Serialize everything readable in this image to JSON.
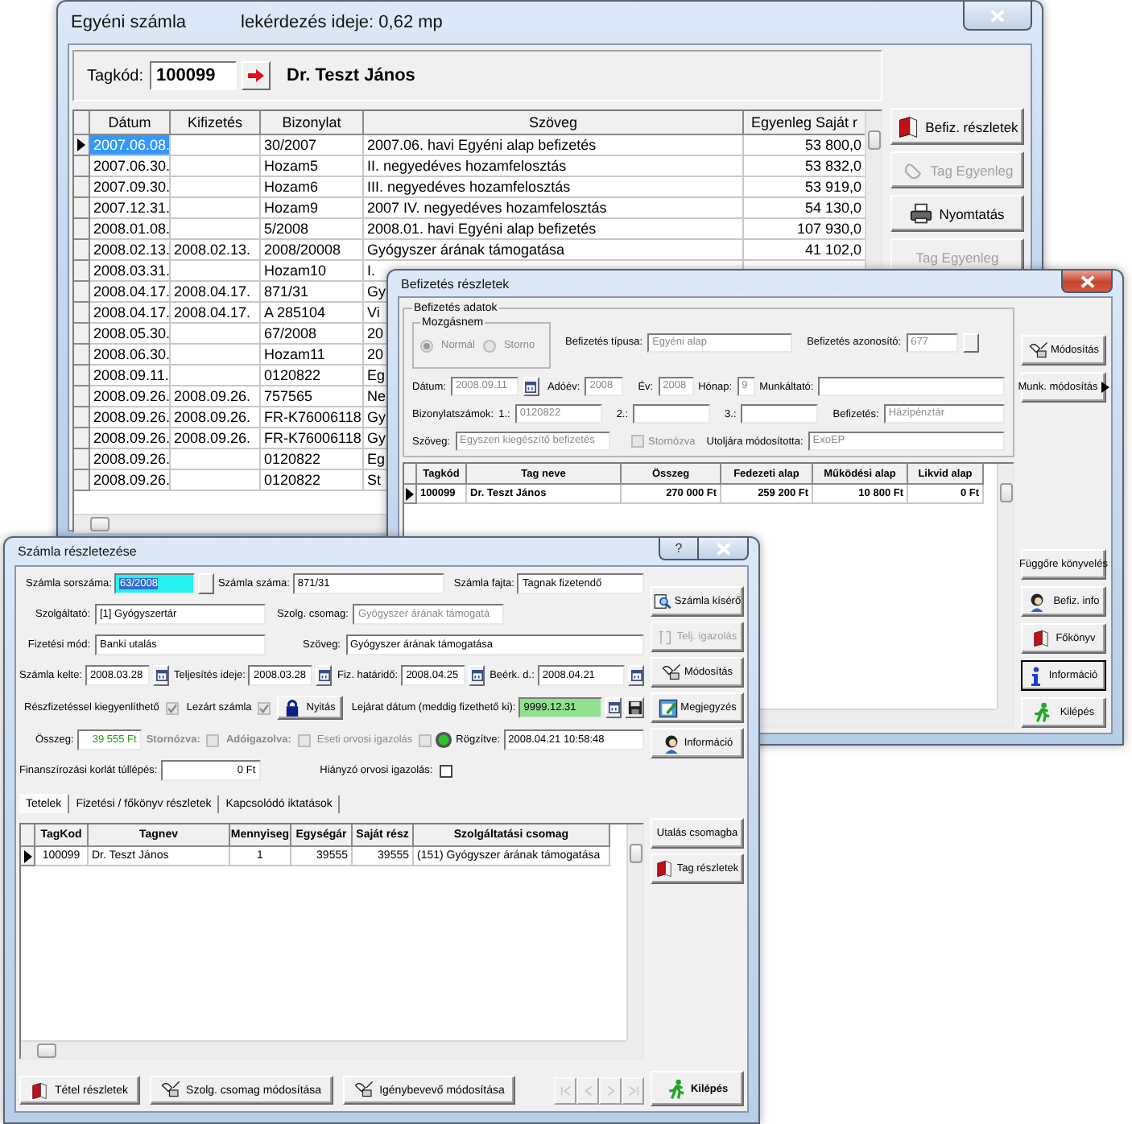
{
  "account_window": {
    "active": false,
    "title": "Egyéni számla",
    "query_time": "lekérdezés ideje: 0,62 mp",
    "member_label": "Tagkód:",
    "member_code": "100099",
    "member_name": "Dr. Teszt János",
    "table": {
      "columns": [
        "Dátum",
        "Kifizetés",
        "Bizonylat",
        "Szöveg",
        "Egyenleg Saját r"
      ],
      "rows": [
        {
          "selected": true,
          "date": "2007.06.08.",
          "document": "30/2007",
          "text": "2007.06. havi Egyéni alap befizetés",
          "balance": "53 800,0"
        },
        {
          "selected": false,
          "date": "2007.06.30.",
          "document": "Hozam5",
          "text": "II. negyedéves hozamfelosztás",
          "balance": "53 832,0"
        },
        {
          "selected": false,
          "date": "2007.09.30.",
          "document": "Hozam6",
          "text": "III. negyedéves hozamfelosztás",
          "balance": "53 919,0"
        },
        {
          "selected": false,
          "date": "2007.12.31.",
          "document": "Hozam9",
          "text": "2007 IV. negyedéves hozamfelosztás",
          "balance": "54 130,0"
        },
        {
          "selected": false,
          "date": "2008.01.08.",
          "document": "5/2008",
          "text": "2008.01. havi Egyéni alap befizetés",
          "balance": "107 930,0"
        },
        {
          "selected": false,
          "date": "2008.02.13.",
          "payout": "2008.02.13.",
          "document": "2008/20008",
          "text": "Gyógyszer árának támogatása",
          "balance": "41 102,0"
        },
        {
          "selected": false,
          "date": "2008.03.31.",
          "document": "Hozam10",
          "text": "I."
        },
        {
          "selected": false,
          "date": "2008.04.17.",
          "payout": "2008.04.17.",
          "document": "871/31",
          "text": "Gy"
        },
        {
          "selected": false,
          "date": "2008.04.17.",
          "payout": "2008.04.17.",
          "document": "A 285104",
          "text": "Vi"
        },
        {
          "selected": false,
          "date": "2008.05.30.",
          "document": "67/2008",
          "text": "20"
        },
        {
          "selected": false,
          "date": "2008.06.30.",
          "document": "Hozam11",
          "text": "20"
        },
        {
          "selected": false,
          "date": "2008.09.11.",
          "document": "0120822",
          "text": "Eg"
        },
        {
          "selected": false,
          "date": "2008.09.26.",
          "payout": "2008.09.26.",
          "document": "757565",
          "text": "Ne"
        },
        {
          "selected": false,
          "date": "2008.09.26.",
          "payout": "2008.09.26.",
          "document": "FR-K76006118",
          "text": "Gy"
        },
        {
          "selected": false,
          "date": "2008.09.26.",
          "payout": "2008.09.26.",
          "document": "FR-K76006118",
          "text": "Gy"
        },
        {
          "selected": false,
          "date": "2008.09.26.",
          "document": "0120822",
          "text": "Eg"
        },
        {
          "selected": false,
          "date": "2008.09.26.",
          "document": "0120822",
          "text": "St"
        }
      ]
    },
    "buttons": [
      {
        "label": "Befiz. részletek",
        "disabled": false
      },
      {
        "label": "Tag Egyenleg",
        "disabled": true
      },
      {
        "label": "Nyomtatás",
        "disabled": false
      },
      {
        "label": "Tag Egyenleg",
        "disabled": true
      }
    ]
  },
  "payment_window": {
    "active": true,
    "title": "Befizetés részletek",
    "group_title": "Befizetés adatok",
    "movement": {
      "title": "Mozgásnem",
      "options": [
        {
          "label": "Normál",
          "selected": true,
          "disabled": true
        },
        {
          "label": "Storno",
          "selected": false,
          "disabled": true
        }
      ]
    },
    "doc_numbers_label": "Bizonylatszámok:",
    "fields": [
      {
        "label": "Befizetés típusa:",
        "value": "Egyéni alap",
        "disabled": true,
        "kind": "text"
      },
      {
        "label": "Befizetés azonosító:",
        "value": "677",
        "disabled": true,
        "kind": "lookup"
      },
      {
        "label": "Dátum:",
        "value": "2008.09.11",
        "disabled": true,
        "kind": "date"
      },
      {
        "label": "Adóév:",
        "value": "2008",
        "disabled": true,
        "kind": "text"
      },
      {
        "label": "Év:",
        "value": "2008",
        "disabled": true,
        "kind": "text"
      },
      {
        "label": "Hónap:",
        "value": "9",
        "disabled": true,
        "kind": "text"
      },
      {
        "label": "Munkáltató:",
        "kind": "text"
      },
      {
        "label": "1.:",
        "value": "0120822",
        "disabled": true,
        "kind": "text"
      },
      {
        "label": "2.:",
        "kind": "text"
      },
      {
        "label": "3.:",
        "kind": "text"
      },
      {
        "label": "Befizetés:",
        "value": "Házipénztár",
        "disabled": true,
        "kind": "text"
      },
      {
        "label": "Szöveg:",
        "value": "Egyszeri kiegészítő befizetés",
        "disabled": true,
        "kind": "text"
      },
      {
        "label": "Utoljára módosította:",
        "value": "ExoEP",
        "disabled": true,
        "kind": "text"
      }
    ],
    "storno": {
      "label": "Stornózva",
      "checked": false,
      "disabled": true
    },
    "top_buttons": [
      {
        "label": "Módosítás"
      },
      {
        "label": "Munk. módosítás"
      }
    ],
    "table": {
      "columns": [
        "Tagkód",
        "Tag neve",
        "Összeg",
        "Fedezeti alap",
        "Működési alap",
        "Likvid alap"
      ],
      "rows": [
        {
          "selected": true,
          "cells": [
            "100099",
            "Dr. Teszt János",
            "270 000 Ft",
            "259 200 Ft",
            "10 800 Ft",
            "0 Ft"
          ]
        }
      ]
    },
    "buttons": [
      {
        "label": "Függőre könyvelés",
        "focused": false
      },
      {
        "label": "Befiz. info",
        "focused": false
      },
      {
        "label": "Főkönyv",
        "focused": false
      },
      {
        "label": "Információ",
        "focused": true
      },
      {
        "label": "Kilépés",
        "focused": false
      }
    ]
  },
  "invoice_window": {
    "active": false,
    "title": "Számla részletezése",
    "help": "?",
    "fields": [
      {
        "label": "Számla sorszáma:",
        "value": "63/2008",
        "kind": "lookup",
        "text_selected": true
      },
      {
        "label": "Számla száma:",
        "value": "871/31",
        "kind": "text"
      },
      {
        "label": "Számla fajta:",
        "value": "Tagnak fizetendő",
        "kind": "text"
      },
      {
        "label": "Szolgáltató:",
        "value": "[1] Gyógyszertár",
        "kind": "text"
      },
      {
        "label": "Szolg. csomag:",
        "value": "Gyógyszer árának támogatá",
        "kind": "text",
        "disabled": true
      },
      {
        "label": "Fizetési mód:",
        "value": "Banki utalás",
        "kind": "text"
      },
      {
        "label": "Szöveg:",
        "value": "Gyógyszer árának támogatása",
        "kind": "text"
      },
      {
        "label": "Számla kelte:",
        "value": "2008.03.28",
        "kind": "date"
      },
      {
        "label": "Teljesítés ideje:",
        "value": "2008.03.28",
        "kind": "date"
      },
      {
        "label": "Fiz. határidő:",
        "value": "2008.04.25",
        "kind": "date"
      },
      {
        "label": "Beérk. d.:",
        "value": "2008.04.21",
        "kind": "date"
      },
      {
        "label": "Lejárat dátum (meddig fizethető ki):",
        "value": "9999.12.31",
        "kind": "date",
        "valid": true
      },
      {
        "label": "Összeg:",
        "value": "39 555 Ft",
        "kind": "text",
        "positive": true
      },
      {
        "label": "Rögzítve:",
        "value": "2008.04.21 10:58:48",
        "kind": "text"
      },
      {
        "label": "Finanszírozási korlát túllépés:",
        "value": "0 Ft",
        "kind": "text"
      }
    ],
    "checkboxes": [
      {
        "label": "Részfizetéssel kiegyenlíthető",
        "checked": true,
        "disabled": true
      },
      {
        "label": "Lezárt számla",
        "checked": true,
        "disabled": true
      },
      {
        "label": "Stornózva:",
        "checked": false,
        "disabled": true
      },
      {
        "label": "Adóigazolva:",
        "checked": false,
        "disabled": true
      },
      {
        "label": "Eseti orvosi igazolás",
        "checked": false,
        "disabled": true
      },
      {
        "label": "Hiányzó orvosi igazolás:",
        "checked": false,
        "disabled": false
      }
    ],
    "unlock_button": "Nyitás",
    "tabs": [
      {
        "label": "Tetelek",
        "selected": true
      },
      {
        "label": "Fizetési / főkönyv  részletek",
        "selected": false
      },
      {
        "label": "Kapcsolódó iktatások",
        "selected": false
      }
    ],
    "table": {
      "columns": [
        "TagKod",
        "Tagnev",
        "Mennyiseg",
        "Egységár",
        "Saját rész",
        "Szolgáltatási csomag"
      ],
      "rows": [
        {
          "selected": true,
          "cells": [
            "100099",
            "Dr. Teszt János",
            "1",
            "39555",
            "39555",
            "(151) Gyógyszer árának támogatása"
          ]
        }
      ]
    },
    "bottom_buttons": [
      {
        "label": "Tétel részletek"
      },
      {
        "label": "Szolg. csomag módosítása"
      },
      {
        "label": "Igénybevevő módosítása"
      }
    ],
    "nav_buttons": [
      {
        "disabled": true
      },
      {
        "disabled": true
      },
      {
        "disabled": true
      },
      {
        "disabled": true
      }
    ],
    "side_buttons": [
      {
        "label": "Számla kísérő",
        "disabled": false
      },
      {
        "label": "Telj. igazolás",
        "disabled": true
      },
      {
        "label": "Módosítás",
        "disabled": false
      },
      {
        "label": "Megjegyzés",
        "disabled": false
      },
      {
        "label": "Információ",
        "disabled": false
      },
      {
        "label": "Utalás csomagba",
        "disabled": false
      },
      {
        "label": "Tag részletek",
        "disabled": false
      },
      {
        "label": "Kilépés",
        "disabled": false
      }
    ]
  }
}
